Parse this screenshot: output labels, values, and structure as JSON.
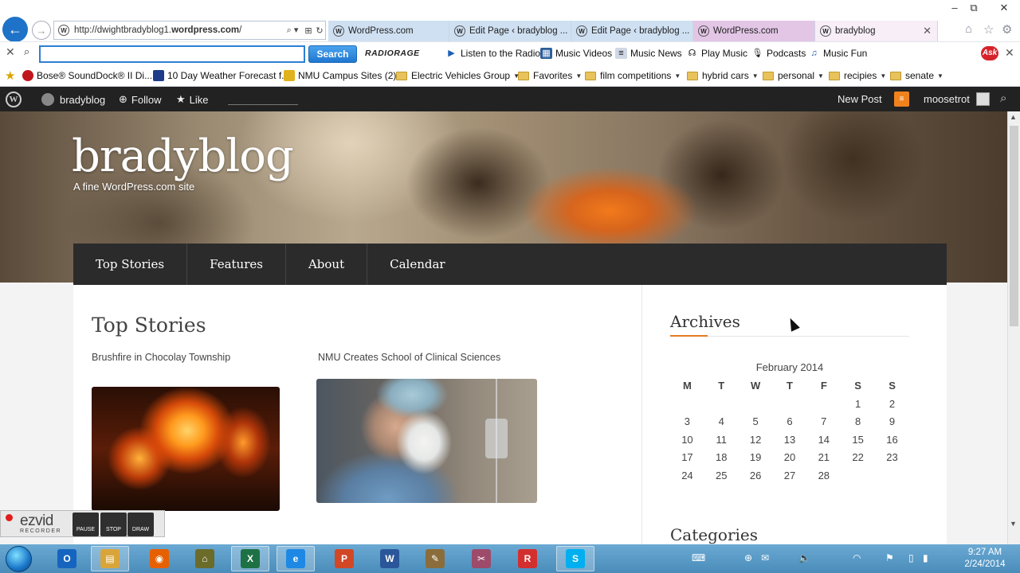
{
  "browser": {
    "url_prefix": "http://dwightbradyblog1.",
    "url_domain": "wordpress.com",
    "url_suffix": "/",
    "address_controls": [
      "⌕ ▾",
      "⊞",
      "↻"
    ],
    "tabs": [
      {
        "label": "WordPress.com"
      },
      {
        "label": "Edit Page ‹ bradyblog ..."
      },
      {
        "label": "Edit Page ‹ bradyblog ..."
      },
      {
        "label": "WordPress.com"
      },
      {
        "label": "bradyblog"
      }
    ],
    "window_controls": {
      "minimize": "–",
      "restore": "⧉",
      "close": "✕"
    },
    "tab_close": "✕"
  },
  "toolbar": {
    "search_placeholder": "",
    "search_button": "Search",
    "radiorage": "RADIORAGE",
    "items": [
      {
        "label": "Listen to the Radio",
        "icon": "play-icon"
      },
      {
        "label": "Music Videos",
        "icon": "film-icon"
      },
      {
        "label": "Music News",
        "icon": "news-icon"
      },
      {
        "label": "Play Music",
        "icon": "headphones-icon"
      },
      {
        "label": "Podcasts",
        "icon": "mic-icon"
      },
      {
        "label": "Music Fun",
        "icon": "note-icon"
      }
    ],
    "ask_label": "Ask"
  },
  "favorites": [
    {
      "label": "Bose® SoundDock® II Di...",
      "type": "site",
      "caret": false
    },
    {
      "label": "10 Day Weather Forecast f...",
      "type": "site",
      "caret": false
    },
    {
      "label": "NMU  Campus Sites (2)",
      "type": "site",
      "caret": false
    },
    {
      "label": "Electric Vehicles Group",
      "type": "folder",
      "caret": true
    },
    {
      "label": "Favorites",
      "type": "folder",
      "caret": true
    },
    {
      "label": "film competitions",
      "type": "folder",
      "caret": true
    },
    {
      "label": "hybrid cars",
      "type": "folder",
      "caret": true
    },
    {
      "label": "personal",
      "type": "folder",
      "caret": true
    },
    {
      "label": "recipies",
      "type": "folder",
      "caret": true
    },
    {
      "label": "senate",
      "type": "folder",
      "caret": true
    }
  ],
  "wpbar": {
    "blog_name": "bradyblog",
    "follow": "Follow",
    "like": "Like",
    "new_post": "New Post",
    "user": "moosetrot"
  },
  "site": {
    "title": "bradyblog",
    "tagline": "A fine WordPress.com site",
    "nav": [
      "Top Stories",
      "Features",
      "About",
      "Calendar"
    ]
  },
  "main": {
    "section_title": "Top Stories",
    "stories": [
      {
        "title": "Brushfire in Chocolay Township"
      },
      {
        "title": "NMU Creates School of Clinical Sciences"
      }
    ]
  },
  "sidebar": {
    "archives_title": "Archives",
    "calendar": {
      "caption": "February 2014",
      "weekdays": [
        "M",
        "T",
        "W",
        "T",
        "F",
        "S",
        "S"
      ],
      "weeks": [
        [
          "",
          "",
          "",
          "",
          "",
          "1",
          "2"
        ],
        [
          "3",
          "4",
          "5",
          "6",
          "7",
          "8",
          "9"
        ],
        [
          "10",
          "11",
          "12",
          "13",
          "14",
          "15",
          "16"
        ],
        [
          "17",
          "18",
          "19",
          "20",
          "21",
          "22",
          "23"
        ],
        [
          "24",
          "25",
          "26",
          "27",
          "28",
          "",
          ""
        ]
      ]
    },
    "categories_title": "Categories"
  },
  "ezvid": {
    "logo": "ezvid",
    "sub": "RECORDER",
    "buttons": [
      "PAUSE",
      "STOP",
      "DRAW"
    ]
  },
  "taskbar": {
    "apps": [
      {
        "name": "outlook",
        "glyph": "O",
        "color": "#1565c0"
      },
      {
        "name": "file-explorer",
        "glyph": "▤",
        "color": "#d9a53a"
      },
      {
        "name": "firefox",
        "glyph": "◉",
        "color": "#e66000"
      },
      {
        "name": "security-lock",
        "glyph": "⌂",
        "color": "#6b6b2a"
      },
      {
        "name": "excel",
        "glyph": "X",
        "color": "#1e7145"
      },
      {
        "name": "internet-explorer",
        "glyph": "e",
        "color": "#1e88e5"
      },
      {
        "name": "powerpoint",
        "glyph": "P",
        "color": "#d24726"
      },
      {
        "name": "word",
        "glyph": "W",
        "color": "#2b579a"
      },
      {
        "name": "paint-tool",
        "glyph": "✎",
        "color": "#8a6d3b"
      },
      {
        "name": "snipping-tool",
        "glyph": "✂",
        "color": "#9e4b6b"
      },
      {
        "name": "recorder-app",
        "glyph": "R",
        "color": "#d32f2f"
      },
      {
        "name": "skype",
        "glyph": "S",
        "color": "#00aff0"
      }
    ],
    "time": "9:27 AM",
    "date": "2/24/2014"
  }
}
